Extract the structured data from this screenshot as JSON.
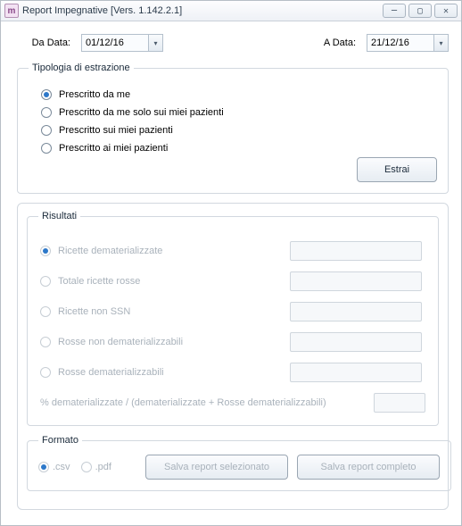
{
  "title": "Report Impegnative [Vers. 1.142.2.1]",
  "dates": {
    "from_label": "Da Data:",
    "from_value": "01/12/16",
    "to_label": "A Data:",
    "to_value": "21/12/16"
  },
  "tipologia": {
    "legend": "Tipologia di estrazione",
    "opts": [
      "Prescritto da me",
      "Prescritto da me solo sui miei pazienti",
      "Prescritto sui miei pazienti",
      "Prescritto ai miei pazienti"
    ],
    "estrai": "Estrai"
  },
  "risultati": {
    "legend": "Risultati",
    "rows": [
      "Ricette dematerializzate",
      "Totale ricette rosse",
      "Ricette non SSN",
      "Rosse non dematerializzabili",
      "Rosse dematerializzabili"
    ],
    "pct_label": "% dematerializzate / (dematerializzate + Rosse dematerializzabili)"
  },
  "formato": {
    "legend": "Formato",
    "csv": ".csv",
    "pdf": ".pdf",
    "salva_sel": "Salva report selezionato",
    "salva_comp": "Salva report completo"
  }
}
